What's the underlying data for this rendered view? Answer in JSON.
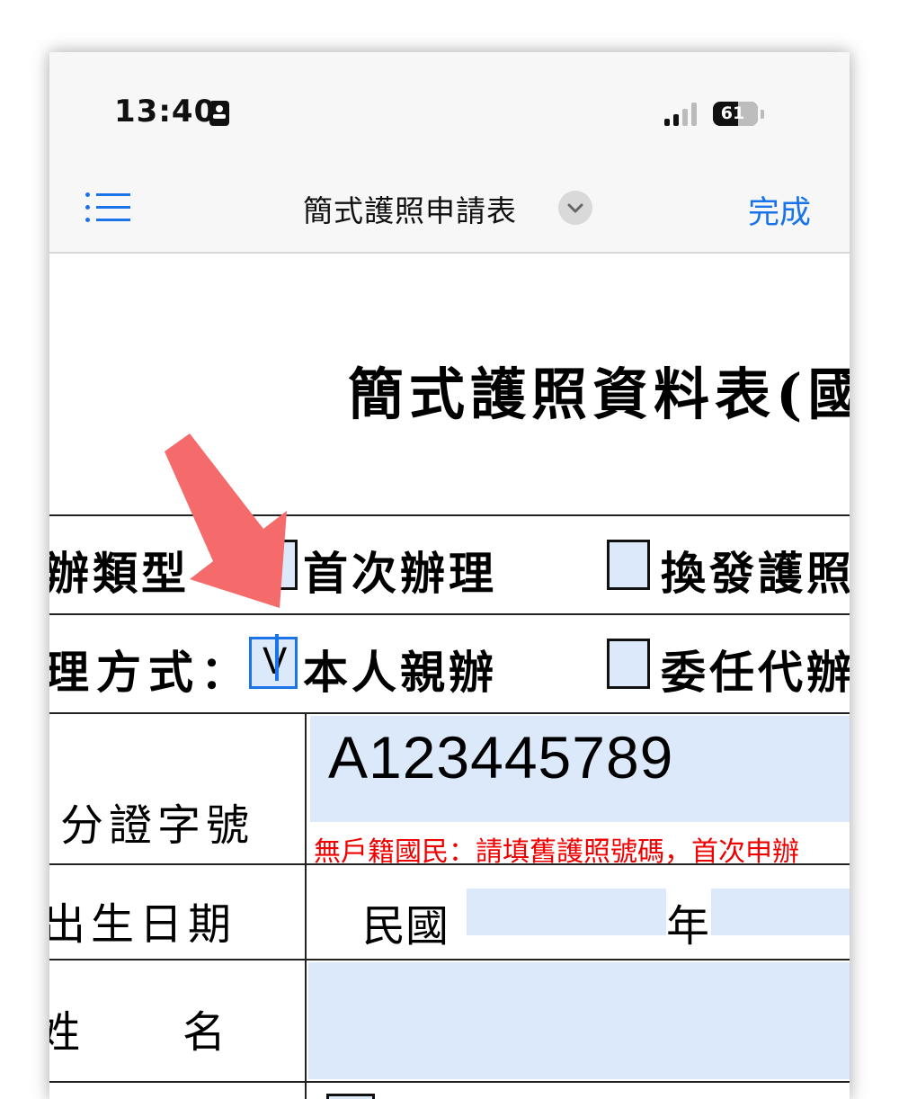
{
  "status_bar": {
    "time": "13:40",
    "battery": "61"
  },
  "nav": {
    "title": "簡式護照申請表",
    "done_label": "完成"
  },
  "document": {
    "title": "簡式護照資料表(國",
    "row1": {
      "label": "辦類型",
      "option1": "首次辦理",
      "option2": "換發護照"
    },
    "row2": {
      "label": "理方式：",
      "option1": "本人親辦",
      "option1_value": "V",
      "option2": "委任代辦"
    },
    "id_row": {
      "label": "分證字號",
      "value": "A123445789",
      "note": "無戶籍國民：請填舊護照號碼，首次申辦"
    },
    "birth_row": {
      "label": "出生日期",
      "era": "民國",
      "year_unit": "年"
    },
    "name_row": {
      "label": "姓　　名"
    }
  },
  "colors": {
    "accent": "#1a73e8",
    "field_bg": "#dce9fb",
    "note_red": "#e00000",
    "arrow": "#f56a6a"
  }
}
